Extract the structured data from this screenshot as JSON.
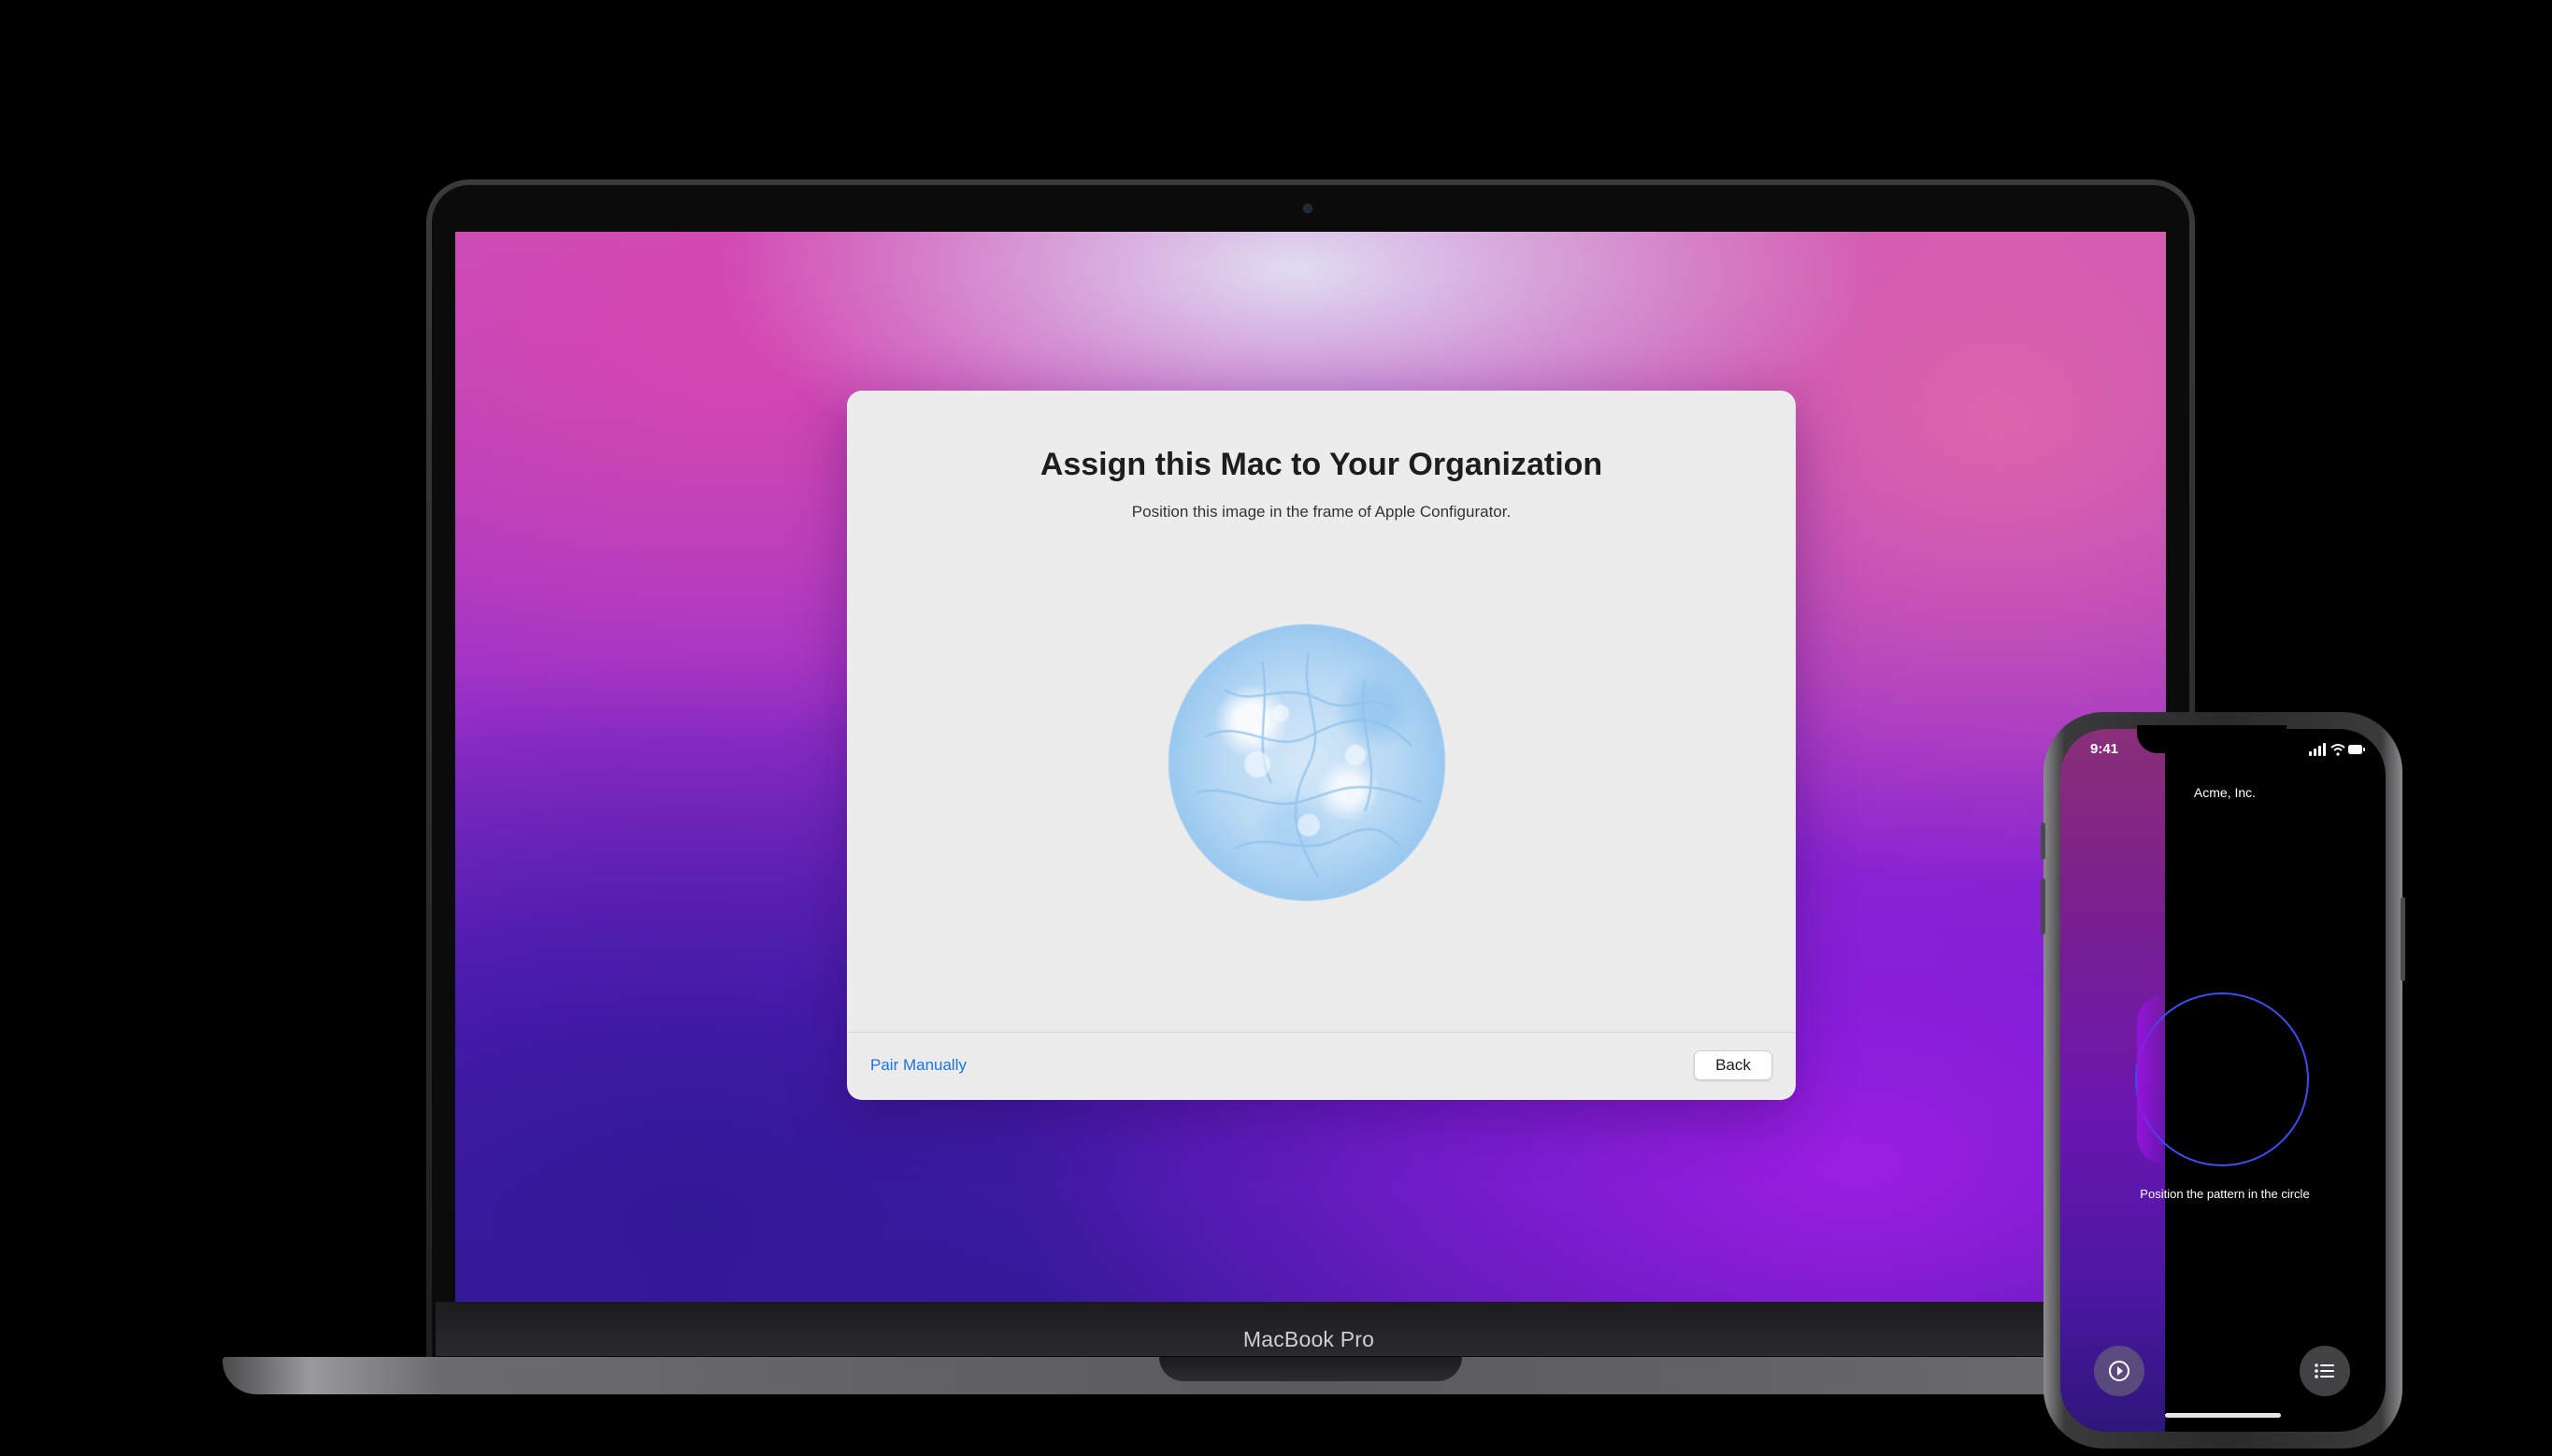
{
  "mac": {
    "model_label": "MacBook Pro",
    "setup": {
      "title": "Assign this Mac to Your Organization",
      "subtitle": "Position this image in the frame of Apple Configurator.",
      "pair_manually": "Pair Manually",
      "back": "Back"
    }
  },
  "phone": {
    "time": "9:41",
    "organization": "Acme, Inc.",
    "instruction": "Position the pattern in the circle",
    "icons": {
      "left_button": "clock-arrow-icon",
      "right_button": "list-icon"
    }
  },
  "colors": {
    "link": "#1a73e8",
    "scan_circle": "#3b4ef0",
    "window_bg": "#ececec"
  }
}
